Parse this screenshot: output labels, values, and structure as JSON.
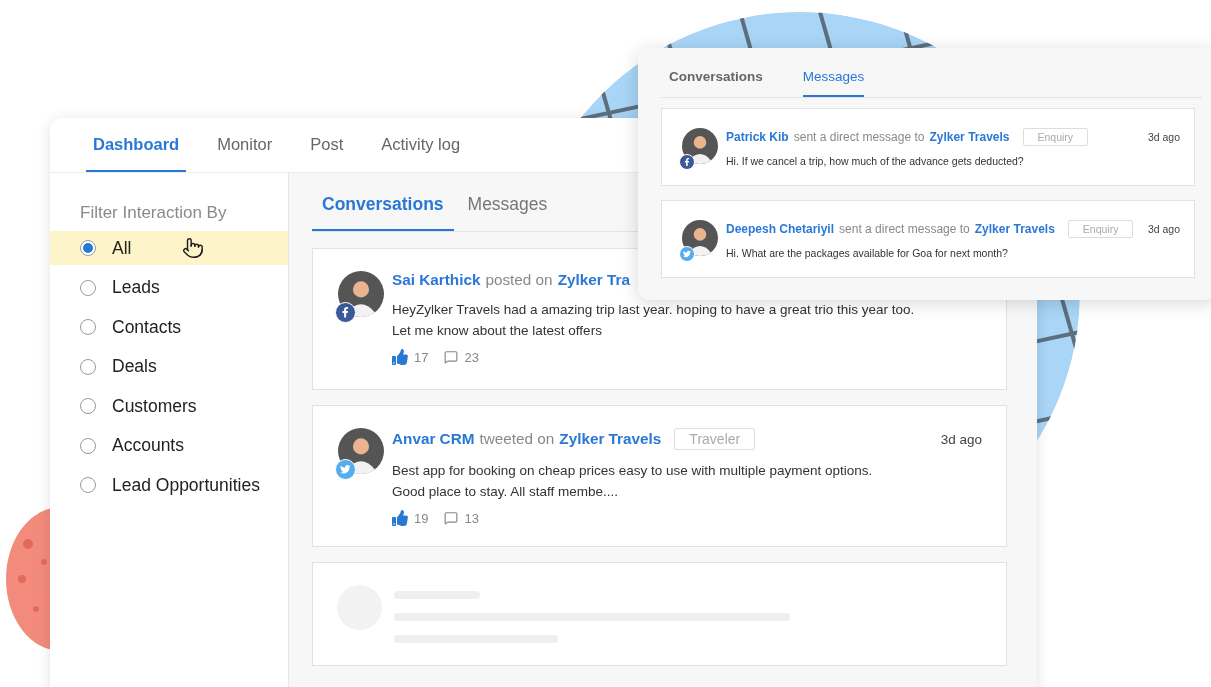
{
  "main_tabs": [
    {
      "label": "Dashboard",
      "selected": true
    },
    {
      "label": "Monitor",
      "selected": false
    },
    {
      "label": "Post",
      "selected": false
    },
    {
      "label": "Activity log",
      "selected": false
    }
  ],
  "filter": {
    "title": "Filter Interaction By",
    "options": [
      {
        "label": "All",
        "selected": true
      },
      {
        "label": "Leads",
        "selected": false
      },
      {
        "label": "Contacts",
        "selected": false
      },
      {
        "label": "Deals",
        "selected": false
      },
      {
        "label": "Customers",
        "selected": false
      },
      {
        "label": "Accounts",
        "selected": false
      },
      {
        "label": "Lead Opportunities",
        "selected": false
      }
    ]
  },
  "content_tabs": [
    {
      "label": "Conversations",
      "selected": true
    },
    {
      "label": "Messages",
      "selected": false
    }
  ],
  "posts": [
    {
      "kind": "post",
      "author": "Sai Karthick",
      "action": "posted on",
      "page": "Zylker Tra",
      "badge": {
        "kind": "facebook"
      },
      "text_lines": [
        "HeyZylker Travels had a amazing trip last year. hoping to have a great trio this year too.",
        "Let me know about the latest offers"
      ],
      "likes": "17",
      "comments": "23"
    },
    {
      "kind": "post",
      "author": "Anvar CRM",
      "action": "tweeted on",
      "page": "Zylker Travels",
      "tag": "Traveler",
      "time": "3d ago",
      "badge": {
        "kind": "twitter"
      },
      "text_lines": [
        "Best app for booking on cheap prices easy to use with multiple payment options.",
        "Good place to stay. All staff membe...."
      ],
      "likes": "19",
      "comments": "13"
    },
    {
      "kind": "placeholder"
    }
  ],
  "popup": {
    "tabs": [
      {
        "label": "Conversations",
        "selected": false
      },
      {
        "label": "Messages",
        "selected": true
      }
    ],
    "messages": [
      {
        "author": "Patrick Kib",
        "action": "sent a direct message to",
        "page": "Zylker Travels",
        "tag": "Enquiry",
        "time": "3d ago",
        "badge": {
          "kind": "facebook"
        },
        "text": "Hi. If we cancel a trip, how much of the advance gets deducted?"
      },
      {
        "author": "Deepesh Chetariyil",
        "action": "sent a direct message to",
        "page": "Zylker Travels",
        "tag": "Enquiry",
        "time": "3d ago",
        "badge": {
          "kind": "twitter"
        },
        "text": "Hi. What are the packages available for Goa for next month?"
      }
    ]
  }
}
